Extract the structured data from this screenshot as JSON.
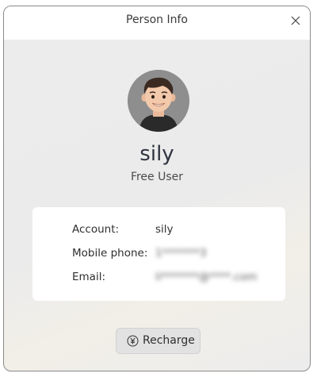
{
  "window": {
    "title": "Person Info",
    "close_icon": "close-icon"
  },
  "profile": {
    "avatar_icon": "avatar-cartoon-man",
    "username": "sily",
    "user_type": "Free User"
  },
  "info": {
    "account_label": "Account:",
    "account_value": "sily",
    "mobile_label": "Mobile phone:",
    "mobile_value": "1*******3",
    "email_label": "Email:",
    "email_value": "li*******@****.com"
  },
  "actions": {
    "recharge_icon": "yen-circle-icon",
    "recharge_label": "Recharge"
  },
  "colors": {
    "card_background": "#ffffff",
    "window_background": "#ececec",
    "button_background": "#e2e2e2",
    "username_color": "#2f3440"
  }
}
